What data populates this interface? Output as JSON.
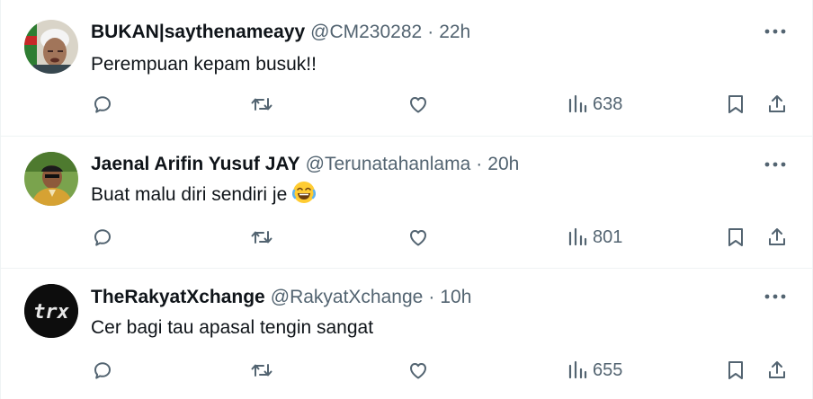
{
  "tweets": [
    {
      "name": "BUKAN|saythenameayy",
      "handle": "@CM230282",
      "dot": "·",
      "time": "22h",
      "text": "Perempuan kepam busuk!!",
      "views": "638"
    },
    {
      "name": "Jaenal Arifin Yusuf JAY",
      "handle": "@Terunatahanlama",
      "dot": "·",
      "time": "20h",
      "text": "Buat malu diri sendiri je",
      "emoji": "face-with-tears-of-joy",
      "views": "801"
    },
    {
      "name": "TheRakyatXchange",
      "handle": "@RakyatXchange",
      "dot": "·",
      "time": "10h",
      "text": "Cer bagi tau apasal tengin sangat",
      "avatar_text": "trx",
      "views": "655"
    }
  ],
  "colors": {
    "text_primary": "#0f1419",
    "text_secondary": "#536471",
    "divider": "#eff3f4"
  },
  "icons": [
    "more-icon",
    "reply-icon",
    "retweet-icon",
    "like-icon",
    "views-icon",
    "bookmark-icon",
    "share-icon"
  ]
}
